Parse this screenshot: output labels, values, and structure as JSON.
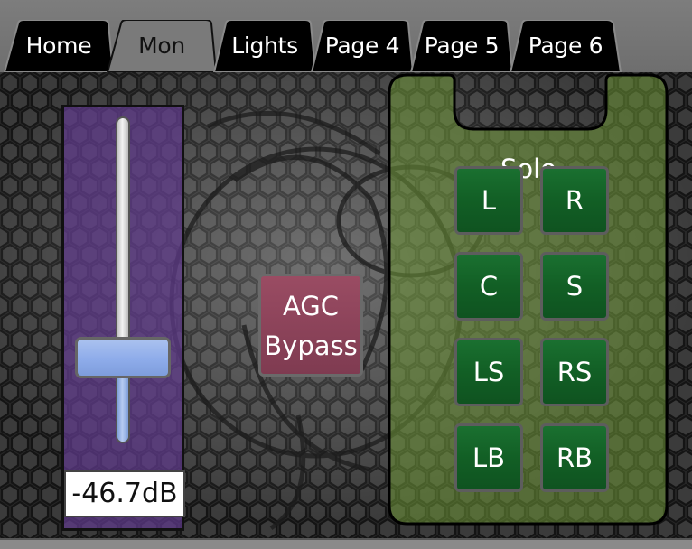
{
  "tabs": [
    {
      "label": "Home",
      "active": false
    },
    {
      "label": "Mon",
      "active": true
    },
    {
      "label": "Lights",
      "active": false
    },
    {
      "label": "Page 4",
      "active": false
    },
    {
      "label": "Page 5",
      "active": false
    },
    {
      "label": "Page 6",
      "active": false
    }
  ],
  "fader": {
    "readout": "-46.7dB",
    "level": 0.22
  },
  "agc": {
    "line1": "AGC",
    "line2": "Bypass"
  },
  "solo": {
    "title": "Solo",
    "buttons": [
      "L",
      "R",
      "C",
      "S",
      "LS",
      "RS",
      "LB",
      "RB"
    ]
  },
  "colors": {
    "fader_bg": "#603a8c",
    "solo_group_bg": "#5c7a32",
    "solo_button": "#136129",
    "agc_button": "#8d455b"
  }
}
